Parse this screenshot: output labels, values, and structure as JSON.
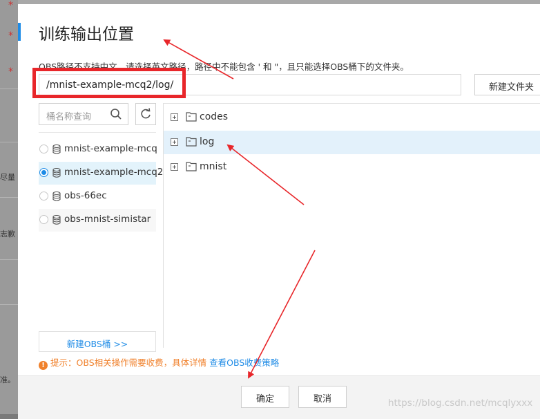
{
  "dialog": {
    "title": "训练输出位置",
    "hint": "OBS路径不支持中文，请选择英文路径，路径中不能包含 ' 和 \"，且只能选择OBS桶下的文件夹。",
    "path_value": "/mnist-example-mcq2/log/",
    "new_folder_label": "新建文件夹",
    "search_placeholder": "桶名称查询",
    "buckets": [
      {
        "name": "mnist-example-mcq",
        "selected": false
      },
      {
        "name": "mnist-example-mcq2",
        "selected": true
      },
      {
        "name": "obs-66ec",
        "selected": false
      },
      {
        "name": "obs-mnist-simistar",
        "selected": false
      }
    ],
    "new_bucket_label": "新建OBS桶 >>",
    "folders": [
      {
        "name": "codes",
        "selected": false
      },
      {
        "name": "log",
        "selected": true
      },
      {
        "name": "mnist",
        "selected": false
      }
    ],
    "tip_text": "提示：OBS相关操作需要收费，具体详情",
    "tip_link": "查看OBS收费策略",
    "ok_label": "确定",
    "cancel_label": "取消",
    "watermark": "https://blog.csdn.net/mcqlyxxx"
  },
  "background": {
    "fragments": [
      "尽量",
      "志歉",
      "准。"
    ]
  },
  "colors": {
    "accent": "#1e8be6",
    "annotation_red": "#e8262a",
    "warning_orange": "#f0812c",
    "selected_bg": "#e3f3fb"
  },
  "icons": {
    "search": "search-icon",
    "refresh": "refresh-icon",
    "bucket": "database-icon",
    "folder": "folder-icon",
    "expand": "expand-plus-icon",
    "tip": "exclamation-circle-icon"
  }
}
